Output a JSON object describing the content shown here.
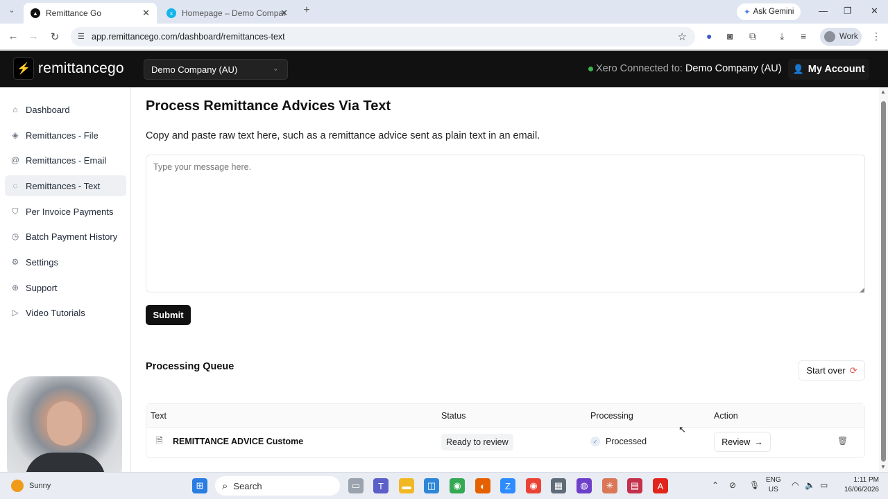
{
  "browser": {
    "tabs": [
      {
        "title": "Remittance Go",
        "active": true
      },
      {
        "title": "Homepage – Demo Company (",
        "active": false
      }
    ],
    "url": "app.remittancego.com/dashboard/remittances-text",
    "gemini_label": "Ask Gemini",
    "profile_label": "Work"
  },
  "header": {
    "logo_text": "remittancego",
    "company_select": "Demo Company (AU)",
    "xero_status_label": "Xero Connected to:",
    "xero_company": "Demo Company (AU)",
    "my_account": "My Account"
  },
  "sidebar": {
    "items": [
      {
        "label": "Dashboard",
        "icon": "home-icon",
        "active": false
      },
      {
        "label": "Remittances - File",
        "icon": "layers-icon",
        "active": false
      },
      {
        "label": "Remittances - Email",
        "icon": "at-icon",
        "active": false
      },
      {
        "label": "Remittances - Text",
        "icon": "chat-icon",
        "active": true
      },
      {
        "label": "Per Invoice Payments",
        "icon": "shield-icon",
        "active": false
      },
      {
        "label": "Batch Payment History",
        "icon": "clock-icon",
        "active": false
      },
      {
        "label": "Settings",
        "icon": "gear-icon",
        "active": false
      },
      {
        "label": "Support",
        "icon": "lifebuoy-icon",
        "active": false
      },
      {
        "label": "Video Tutorials",
        "icon": "play-icon",
        "active": false
      }
    ]
  },
  "main": {
    "title": "Process Remittance Advices Via Text",
    "description": "Copy and paste raw text here, such as a remittance advice sent as plain text in an email.",
    "textarea_placeholder": "Type your message here.",
    "submit_label": "Submit",
    "queue_title": "Processing Queue",
    "start_over_label": "Start over",
    "table": {
      "columns": [
        "Text",
        "Status",
        "Processing",
        "Action"
      ],
      "rows": [
        {
          "text": "REMITTANCE ADVICE Custome",
          "status": "Ready to review",
          "processing": "Processed",
          "action": "Review"
        }
      ]
    }
  },
  "taskbar": {
    "weather": "Sunny",
    "search_placeholder": "Search",
    "lang_line1": "ENG",
    "lang_line2": "US",
    "time": "1:11 PM",
    "date": "16/06/2026"
  }
}
